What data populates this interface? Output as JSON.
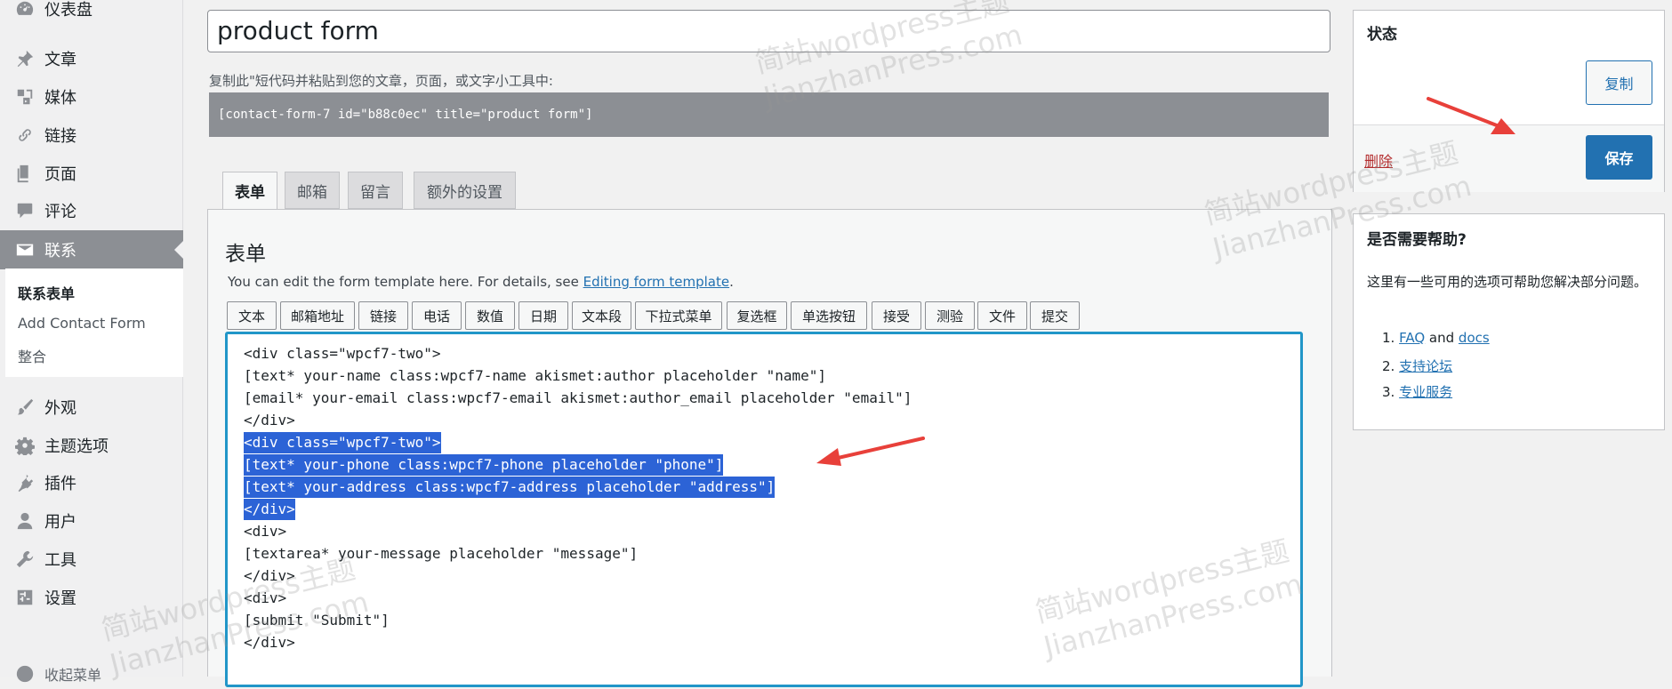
{
  "sidebar": {
    "items": [
      {
        "label": "仪表盘",
        "icon": "dashboard-icon"
      },
      {
        "label": "文章",
        "icon": "pin-icon"
      },
      {
        "label": "媒体",
        "icon": "media-icon"
      },
      {
        "label": "链接",
        "icon": "link-icon"
      },
      {
        "label": "页面",
        "icon": "page-icon"
      },
      {
        "label": "评论",
        "icon": "comment-icon"
      },
      {
        "label": "联系",
        "icon": "mail-icon"
      },
      {
        "label": "外观",
        "icon": "brush-icon"
      },
      {
        "label": "主题选项",
        "icon": "gear-icon"
      },
      {
        "label": "插件",
        "icon": "plugin-icon"
      },
      {
        "label": "用户",
        "icon": "user-icon"
      },
      {
        "label": "工具",
        "icon": "wrench-icon"
      },
      {
        "label": "设置",
        "icon": "settings-icon"
      }
    ],
    "submenu": [
      "联系表单",
      "Add Contact Form",
      "整合"
    ],
    "collapse_label": "收起菜单"
  },
  "form": {
    "title_value": "product form",
    "shortcode_label": "复制此\"短代码并粘贴到您的文章，页面，或文字小工具中:",
    "shortcode": "[contact-form-7 id=\"b88c0ec\" title=\"product form\"]",
    "tabs": [
      "表单",
      "邮箱",
      "留言",
      "额外的设置"
    ],
    "panel_title": "表单",
    "desc_prefix": "You can edit the form template here. For details, see ",
    "desc_link": "Editing form template",
    "desc_suffix": ".",
    "tag_buttons": [
      "文本",
      "邮箱地址",
      "链接",
      "电话",
      "数值",
      "日期",
      "文本段",
      "下拉式菜单",
      "复选框",
      "单选按钮",
      "接受",
      "测验",
      "文件",
      "提交"
    ],
    "code_lines": [
      "<div class=\"wpcf7-two\">",
      "[text* your-name class:wpcf7-name akismet:author placeholder \"name\"]",
      "[email* your-email class:wpcf7-email akismet:author_email placeholder \"email\"]",
      "</div>",
      "<div class=\"wpcf7-two\">",
      "[text* your-phone class:wpcf7-phone placeholder \"phone\"]",
      "[text* your-address class:wpcf7-address placeholder \"address\"]",
      "</div>",
      "<div>",
      "[textarea* your-message placeholder \"message\"]",
      "</div>",
      "<div>",
      "[submit \"Submit\"]",
      "</div>"
    ],
    "selected_lines": [
      4,
      5,
      6,
      7
    ]
  },
  "status_box": {
    "title": "状态",
    "copy_label": "复制",
    "delete_label": "删除",
    "save_label": "保存"
  },
  "help_box": {
    "title": "是否需要帮助?",
    "text": "这里有一些可用的选项可帮助您解决部分问题。",
    "items": [
      {
        "num": "1.",
        "link1": "FAQ",
        "mid": " and ",
        "link2": "docs"
      },
      {
        "num": "2.",
        "link1": "支持论坛"
      },
      {
        "num": "3.",
        "link1": "专业服务"
      }
    ]
  },
  "watermark": {
    "line1": "简站wordpress主题",
    "line2": "JianzhanPress.com"
  },
  "colors": {
    "accent": "#2271b1",
    "selection": "#2c63d6",
    "arrow": "#e8403a",
    "editor_border": "#2196c8"
  }
}
